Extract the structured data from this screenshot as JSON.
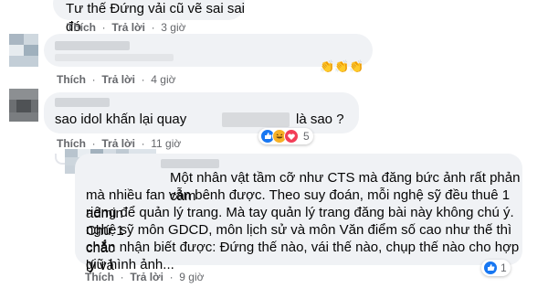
{
  "comment1": {
    "text": "Tư thế Đứng vải cũ vẽ sai sai đó",
    "actions": {
      "like": "Thích",
      "reply": "Trả lời",
      "time": "3 giờ"
    }
  },
  "comment2": {
    "reaction_icons": [
      "clapping-hands",
      "clapping-hands",
      "clapping-hands"
    ],
    "actions": {
      "like": "Thích",
      "reply": "Trả lời",
      "time": "4 giờ"
    }
  },
  "comment3": {
    "text_before": "sao idol khấn lại quay",
    "text_after": "là sao ?",
    "reactions": {
      "icons": [
        "like",
        "haha",
        "love"
      ],
      "count": "5"
    },
    "actions": {
      "like": "Thích",
      "reply": "Trả lời",
      "time": "11 giờ"
    }
  },
  "comment4": {
    "text_lines": [
      "Một nhân vật tầm cỡ như CTS mà đăng bức ảnh rất phản cảm",
      "mà nhiều fan vẫn bênh được. Theo suy đoán, mỗi nghệ sỹ đều thuê 1 admin",
      "riêng để quản lý trang. Mà tay quản lý trang đăng bài này không chú ý. Chứ 1",
      "nghệ sỹ môn GDCD, môn lịch sử và môn Văn điểm số cao như thế thì chắc",
      "chắn nhận biết được: Đứng thế nào, vái thế nào, chụp thế nào cho hợp lý và",
      "giữ hình ảnh..."
    ],
    "reactions": {
      "icons": [
        "like"
      ],
      "count": "1"
    },
    "actions": {
      "like": "Thích",
      "reply": "Trả lời",
      "time": "9 giờ"
    }
  },
  "colors": {
    "bubble": "#f0f2f5",
    "meta": "#65676b",
    "like_blue": "#1877f2"
  }
}
